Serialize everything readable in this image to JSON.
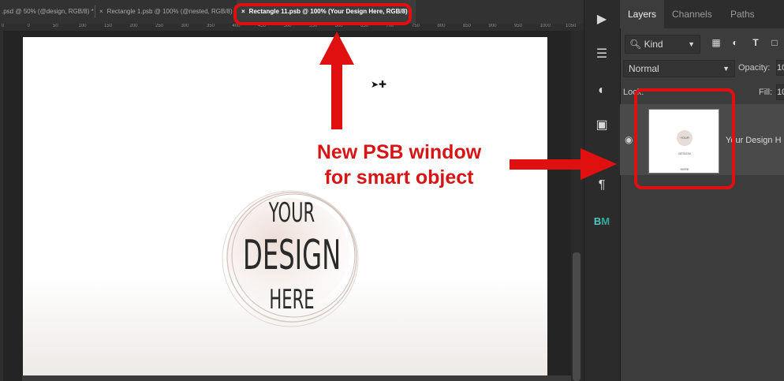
{
  "tabs": [
    {
      "label": ".psd @ 50% (@design, RGB/8) *",
      "close": "×"
    },
    {
      "label": "Rectangle 1.psb @ 100% (@nested, RGB/8)",
      "close": "×"
    },
    {
      "label": "Rectangle 11.psb @ 100% (Your Design Here, RGB/8)",
      "close": "×"
    }
  ],
  "ruler": {
    "ticks": [
      "0",
      "0",
      "50",
      "100",
      "150",
      "200",
      "250",
      "300",
      "350",
      "400",
      "450",
      "500",
      "550",
      "600",
      "650",
      "700",
      "750",
      "800",
      "850",
      "900",
      "950",
      "1000",
      "1050"
    ]
  },
  "canvas": {
    "logo_lines": [
      "YOUR",
      "DESIGN",
      "HERE"
    ]
  },
  "panel": {
    "tabs": [
      "Layers",
      "Channels",
      "Paths"
    ],
    "filter": {
      "kind": "Kind"
    },
    "blend_mode": "Normal",
    "opacity_label": "Opacity:",
    "opacity_value": "10",
    "lock_label": "Lock:",
    "fill_label": "Fill:",
    "fill_value": "10",
    "layer": {
      "name": "Your Design H",
      "thumb_text": "YOUR DESIGN HERE"
    }
  },
  "annotation": {
    "line1": "New PSB window",
    "line2": "for smart object",
    "color": "#d81414"
  },
  "tools": [
    "play-icon",
    "sliders-icon",
    "adjustment-circle-icon",
    "image-frame-icon",
    "paragraph-icon",
    "plugin-icon"
  ],
  "colors": {
    "annotation_red": "#e01010",
    "panel_bg": "#3c3c3c",
    "canvas_bg": "#242424"
  }
}
